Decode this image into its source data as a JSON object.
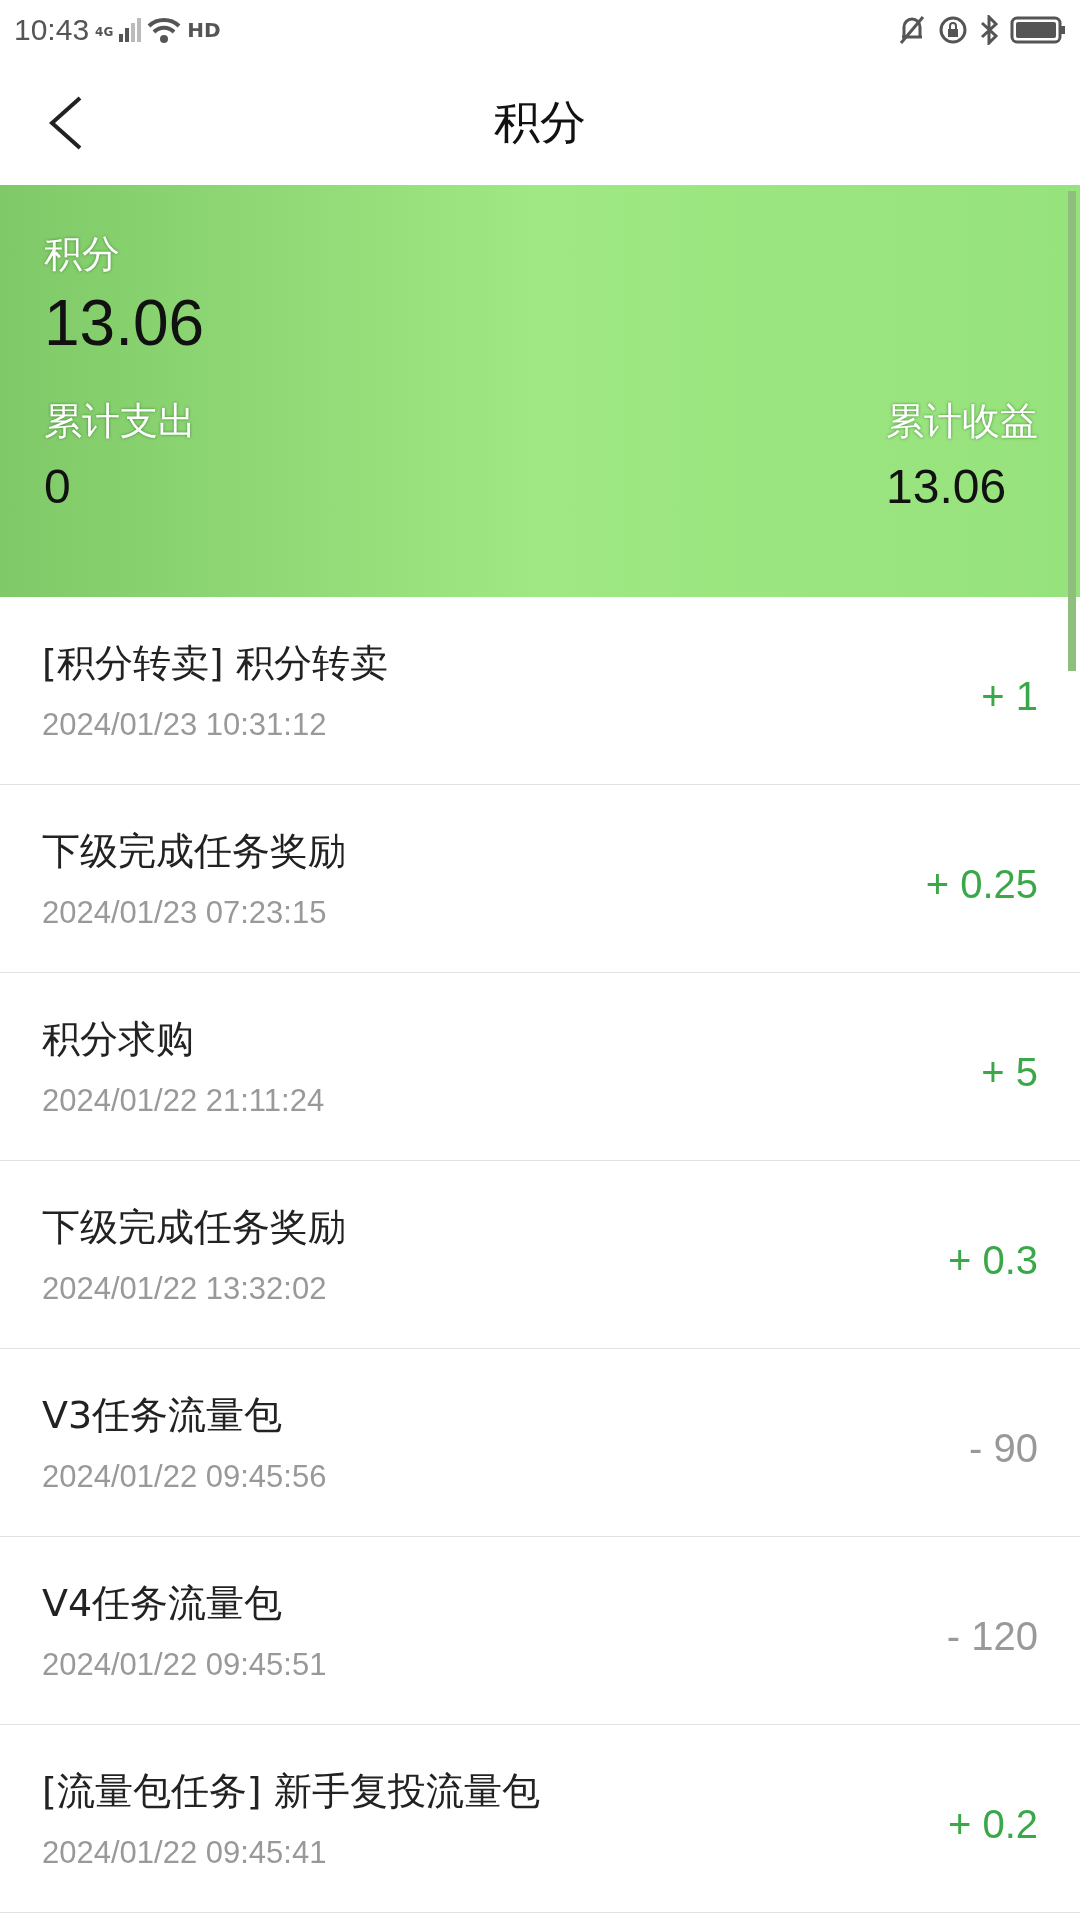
{
  "status_bar": {
    "time": "10:43",
    "network": "4G",
    "hd": "HD"
  },
  "header": {
    "title": "积分"
  },
  "summary": {
    "label": "积分",
    "value": "13.06",
    "spent_label": "累计支出",
    "spent": "0",
    "earned_label": "累计收益",
    "earned": "13.06"
  },
  "records": [
    {
      "title": "[积分转卖] 积分转卖",
      "time": "2024/01/23 10:31:12",
      "amount": "+ 1",
      "kind": "income"
    },
    {
      "title": "下级完成任务奖励",
      "time": "2024/01/23 07:23:15",
      "amount": "+ 0.25",
      "kind": "income"
    },
    {
      "title": "积分求购",
      "time": "2024/01/22 21:11:24",
      "amount": "+ 5",
      "kind": "income"
    },
    {
      "title": "下级完成任务奖励",
      "time": "2024/01/22 13:32:02",
      "amount": "+ 0.3",
      "kind": "income"
    },
    {
      "title": "V3任务流量包",
      "time": "2024/01/22 09:45:56",
      "amount": "- 90",
      "kind": "expense"
    },
    {
      "title": "V4任务流量包",
      "time": "2024/01/22 09:45:51",
      "amount": "- 120",
      "kind": "expense"
    },
    {
      "title": "[流量包任务] 新手复投流量包",
      "time": "2024/01/22 09:45:41",
      "amount": "+ 0.2",
      "kind": "income"
    }
  ]
}
